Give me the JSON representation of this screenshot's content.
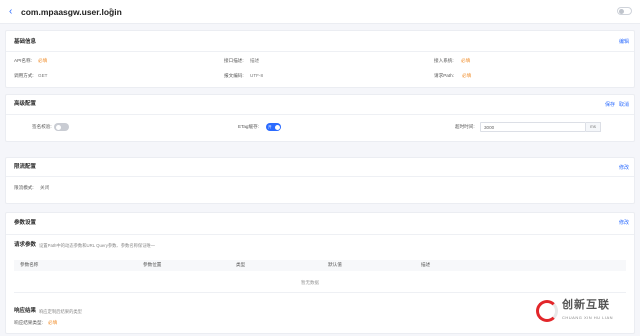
{
  "header": {
    "back_glyph": "‹",
    "title": "com.mpaasgw.user.login",
    "edit_glyph": "✎"
  },
  "basic": {
    "title": "基础信息",
    "action": "编辑",
    "fields": [
      {
        "label": "API名称:",
        "value": "必填",
        "required": true
      },
      {
        "label": "接口描述:",
        "value": "描述",
        "required": false
      },
      {
        "label": "接入系统:",
        "value": "必填",
        "required": true
      },
      {
        "label": "调用方式:",
        "value": "GET",
        "required": false
      },
      {
        "label": "报文编码:",
        "value": "UTF-8",
        "required": false
      },
      {
        "label": "请求Path:",
        "value": "必填",
        "required": true
      }
    ]
  },
  "advanced": {
    "title": "高级配置",
    "action_save": "保存",
    "action_cancel": "取消",
    "sign_label": "签名校验:",
    "etag_label": "ETag缓存:",
    "etag_on_text": "开",
    "timeout_label": "超时时间:",
    "timeout_value": "3000",
    "timeout_unit": "ms"
  },
  "limit": {
    "title": "限流配置",
    "action": "修改",
    "mode_label": "限流模式:",
    "mode_value": "关闭"
  },
  "params": {
    "title": "参数设置",
    "action": "修改",
    "request_title": "请求参数",
    "request_hint": "设置Path中的动态参数和URL Query参数、参数名称保证唯一",
    "columns": [
      "参数名称",
      "参数位置",
      "类型",
      "默认值",
      "描述"
    ],
    "empty_text": "暂无数据",
    "response_title": "响应结果",
    "response_hint": "响应定制后结果的类型",
    "response_type_label": "响应结果类型:",
    "response_type_value": "必填"
  },
  "watermark": {
    "cn": "创新互联",
    "en": "CHUANG XIN HU LIAN"
  },
  "colors": {
    "accent": "#2b6bff",
    "required": "#f08a24",
    "background": "#f5f6fa"
  },
  "icons": [
    "back-arrow-icon",
    "edit-pencil-icon",
    "header-toggle",
    "brand-logo-icon"
  ]
}
